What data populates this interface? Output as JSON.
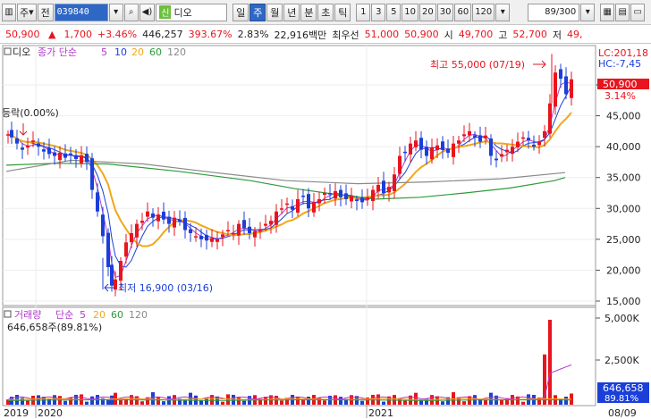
{
  "toolbar": {
    "stock_type": "주",
    "prev_label": "전",
    "code": "039840",
    "badge": "신",
    "name": "디오",
    "periods": [
      "일",
      "주",
      "월",
      "년",
      "분",
      "초",
      "틱"
    ],
    "active_period": "주",
    "numbers": [
      "1",
      "3",
      "5",
      "10",
      "20",
      "30",
      "60",
      "120"
    ],
    "count": "89/300"
  },
  "info": {
    "price": "50,900",
    "arrow": "▲",
    "change": "1,700",
    "change_pct": "+3.46%",
    "volume": "446,257",
    "ratio": "393.67%",
    "turnover": "2.83%",
    "amount": "22,916백만",
    "best_sell_label": "최우선",
    "best_sell": "51,000",
    "best_buy": "50,900",
    "open_label": "시",
    "open": "49,700",
    "high_label": "고",
    "high": "52,700",
    "low_label": "저",
    "low": "49,"
  },
  "price_panel": {
    "legend_name": "디오",
    "ma_label": "종가 단순",
    "ma_periods": [
      "5",
      "10",
      "20",
      "60",
      "120"
    ],
    "lc": "LC:201,18",
    "hc": "HC:-7,45",
    "current_price": "50,900",
    "current_pct": "3.14%",
    "y_ticks": [
      "50,000",
      "45,000",
      "40,000",
      "35,000",
      "30,000",
      "25,000",
      "20,000",
      "15,000"
    ],
    "ann_high": "최고 55,000 (07/19)",
    "ann_low": "최저 16,900 (03/16)",
    "ann_left": "등락(0.00%)"
  },
  "volume_panel": {
    "label": "거래량",
    "ma_label": "단순",
    "ma_periods": [
      "5",
      "20",
      "60",
      "120"
    ],
    "current": "646,658주(89.81%)",
    "y_ticks": [
      "5,000K",
      "2,500K"
    ],
    "current_value": "646,658",
    "current_pct": "89.81%"
  },
  "x_axis": {
    "labels": [
      "2019",
      "2020",
      "2021"
    ],
    "right_label": "08/09"
  },
  "colors": {
    "up": "#e8141e",
    "down": "#1b3fd8",
    "ma5": "#b23acb",
    "ma10": "#1b3fd8",
    "ma20": "#f0a818",
    "ma60": "#2e9a3a",
    "ma120": "#8a8a8a"
  }
}
